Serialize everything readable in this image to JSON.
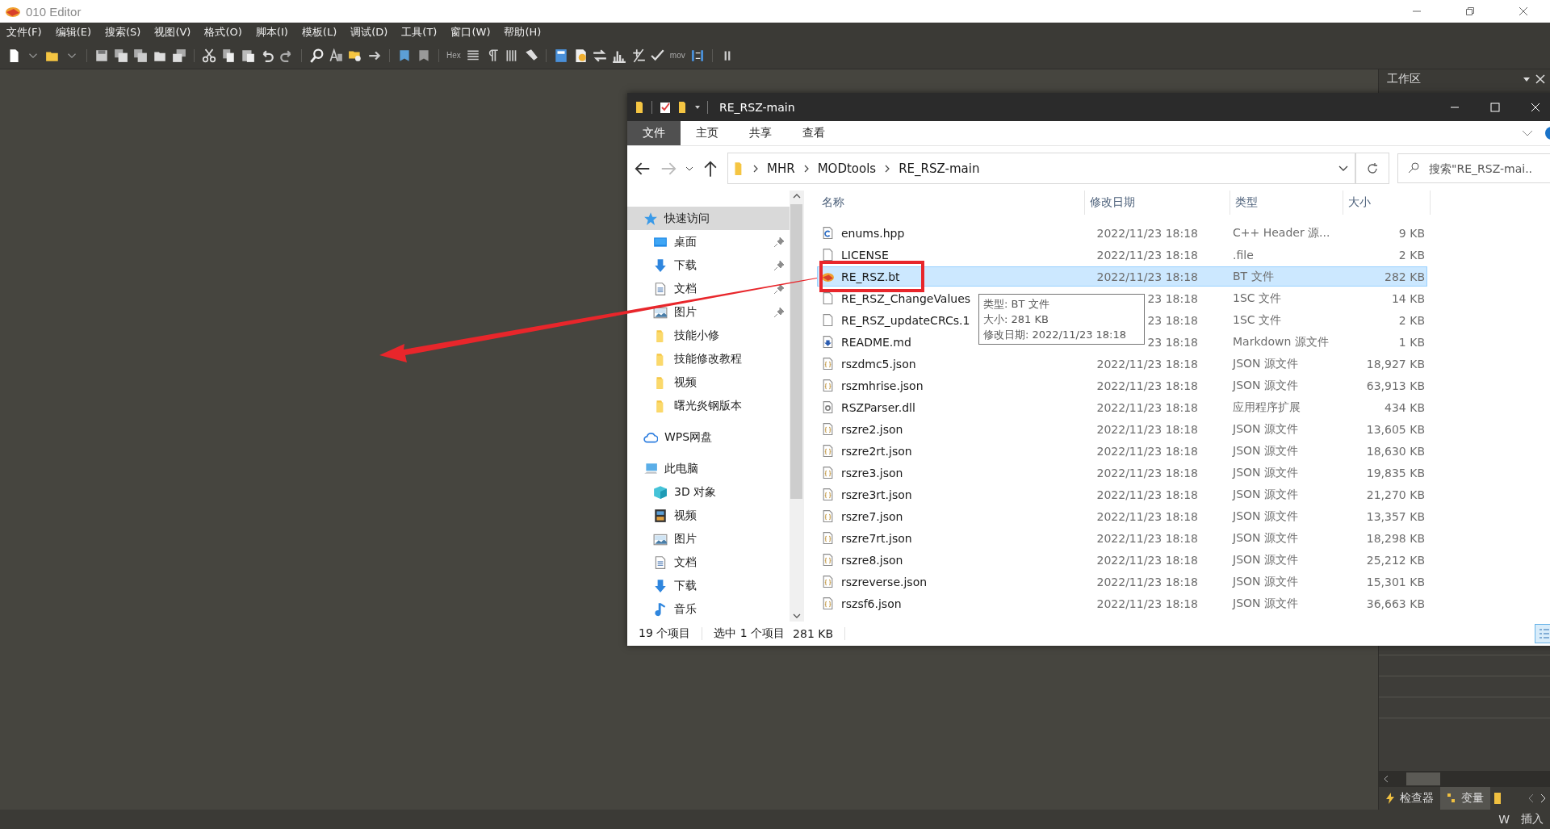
{
  "app": {
    "title": "010 Editor"
  },
  "menu": [
    {
      "label": "文件(F)"
    },
    {
      "label": "编辑(E)"
    },
    {
      "label": "搜索(S)"
    },
    {
      "label": "视图(V)"
    },
    {
      "label": "格式(O)"
    },
    {
      "label": "脚本(I)"
    },
    {
      "label": "模板(L)"
    },
    {
      "label": "调试(D)"
    },
    {
      "label": "工具(T)"
    },
    {
      "label": "窗口(W)"
    },
    {
      "label": "帮助(H)"
    }
  ],
  "toolbar": {
    "labels": [
      "Hex",
      "mov"
    ]
  },
  "workspace_panel": {
    "title": "工作区",
    "tabs": [
      {
        "label": "检查器",
        "selected": false
      },
      {
        "label": "变量",
        "selected": true
      }
    ]
  },
  "status_bar": {
    "items": [
      "W",
      "插入"
    ]
  },
  "explorer": {
    "title": "RE_RSZ-main",
    "ribbon_tabs": [
      {
        "label": "文件",
        "selected": true
      },
      {
        "label": "主页",
        "selected": false
      },
      {
        "label": "共享",
        "selected": false
      },
      {
        "label": "查看",
        "selected": false
      }
    ],
    "breadcrumb": [
      "MHR",
      "MODtools",
      "RE_RSZ-main"
    ],
    "search": {
      "placeholder": "搜索\"RE_RSZ-mai.."
    },
    "sidebar": [
      {
        "label": "快速访问",
        "kind": "star",
        "selected": true,
        "children": [
          {
            "label": "桌面",
            "kind": "desktop",
            "selected": false,
            "pinned": true
          },
          {
            "label": "下载",
            "kind": "download",
            "selected": false,
            "pinned": true
          },
          {
            "label": "文档",
            "kind": "document",
            "selected": false,
            "pinned": true
          },
          {
            "label": "图片",
            "kind": "picture",
            "selected": false,
            "pinned": true
          },
          {
            "label": "技能小修",
            "kind": "folder",
            "selected": false,
            "pinned": false
          },
          {
            "label": "技能修改教程",
            "kind": "folder",
            "selected": false,
            "pinned": false
          },
          {
            "label": "视频",
            "kind": "folder",
            "selected": false,
            "pinned": false
          },
          {
            "label": "曙光炎钢版本",
            "kind": "folder",
            "selected": false,
            "pinned": false
          }
        ]
      },
      {
        "label": "WPS网盘",
        "kind": "cloud",
        "selected": false
      },
      {
        "label": "此电脑",
        "kind": "computer",
        "selected": false,
        "children": [
          {
            "label": "3D 对象",
            "kind": "cube",
            "selected": false
          },
          {
            "label": "视频",
            "kind": "video",
            "selected": false
          },
          {
            "label": "图片",
            "kind": "picture",
            "selected": false
          },
          {
            "label": "文档",
            "kind": "document",
            "selected": false
          },
          {
            "label": "下载",
            "kind": "download",
            "selected": false
          },
          {
            "label": "音乐",
            "kind": "music",
            "selected": false
          }
        ]
      }
    ],
    "columns": [
      "名称",
      "修改日期",
      "类型",
      "大小"
    ],
    "files": [
      {
        "name": "enums.hpp",
        "kind": "code",
        "date": "2022/11/23 18:18",
        "type": "C++ Header 源...",
        "size": "9 KB",
        "selected": false
      },
      {
        "name": "LICENSE",
        "kind": "blank",
        "date": "2022/11/23 18:18",
        "type": ".file",
        "size": "2 KB",
        "selected": false
      },
      {
        "name": "RE_RSZ.bt",
        "kind": "bt",
        "date": "2022/11/23 18:18",
        "type": "BT 文件",
        "size": "282 KB",
        "selected": true
      },
      {
        "name": "RE_RSZ_ChangeValues",
        "kind": "blank",
        "date": "23 18:18",
        "type": "1SC 文件",
        "size": "14 KB",
        "selected": false
      },
      {
        "name": "RE_RSZ_updateCRCs.1",
        "kind": "blank",
        "date": "23 18:18",
        "type": "1SC 文件",
        "size": "2 KB",
        "selected": false
      },
      {
        "name": "README.md",
        "kind": "markdown",
        "date": "23 18:18",
        "type": "Markdown 源文件",
        "size": "1 KB",
        "selected": false
      },
      {
        "name": "rszdmc5.json",
        "kind": "json",
        "date": "2022/11/23 18:18",
        "type": "JSON 源文件",
        "size": "18,927 KB",
        "selected": false
      },
      {
        "name": "rszmhrise.json",
        "kind": "json",
        "date": "2022/11/23 18:18",
        "type": "JSON 源文件",
        "size": "63,913 KB",
        "selected": false
      },
      {
        "name": "RSZParser.dll",
        "kind": "dll",
        "date": "2022/11/23 18:18",
        "type": "应用程序扩展",
        "size": "434 KB",
        "selected": false
      },
      {
        "name": "rszre2.json",
        "kind": "json",
        "date": "2022/11/23 18:18",
        "type": "JSON 源文件",
        "size": "13,605 KB",
        "selected": false
      },
      {
        "name": "rszre2rt.json",
        "kind": "json",
        "date": "2022/11/23 18:18",
        "type": "JSON 源文件",
        "size": "18,630 KB",
        "selected": false
      },
      {
        "name": "rszre3.json",
        "kind": "json",
        "date": "2022/11/23 18:18",
        "type": "JSON 源文件",
        "size": "19,835 KB",
        "selected": false
      },
      {
        "name": "rszre3rt.json",
        "kind": "json",
        "date": "2022/11/23 18:18",
        "type": "JSON 源文件",
        "size": "21,270 KB",
        "selected": false
      },
      {
        "name": "rszre7.json",
        "kind": "json",
        "date": "2022/11/23 18:18",
        "type": "JSON 源文件",
        "size": "13,357 KB",
        "selected": false
      },
      {
        "name": "rszre7rt.json",
        "kind": "json",
        "date": "2022/11/23 18:18",
        "type": "JSON 源文件",
        "size": "18,298 KB",
        "selected": false
      },
      {
        "name": "rszre8.json",
        "kind": "json",
        "date": "2022/11/23 18:18",
        "type": "JSON 源文件",
        "size": "25,212 KB",
        "selected": false
      },
      {
        "name": "rszreverse.json",
        "kind": "json",
        "date": "2022/11/23 18:18",
        "type": "JSON 源文件",
        "size": "15,301 KB",
        "selected": false
      },
      {
        "name": "rszsf6.json",
        "kind": "json",
        "date": "2022/11/23 18:18",
        "type": "JSON 源文件",
        "size": "36,663 KB",
        "selected": false
      }
    ],
    "tooltip": {
      "lines": [
        "类型: BT 文件",
        "大小: 281 KB",
        "修改日期: 2022/11/23 18:18"
      ]
    },
    "status": [
      "19 个项目",
      "选中 1 个项目",
      "281 KB"
    ]
  },
  "annotations": {
    "arrow": true,
    "highlight_box": true
  }
}
